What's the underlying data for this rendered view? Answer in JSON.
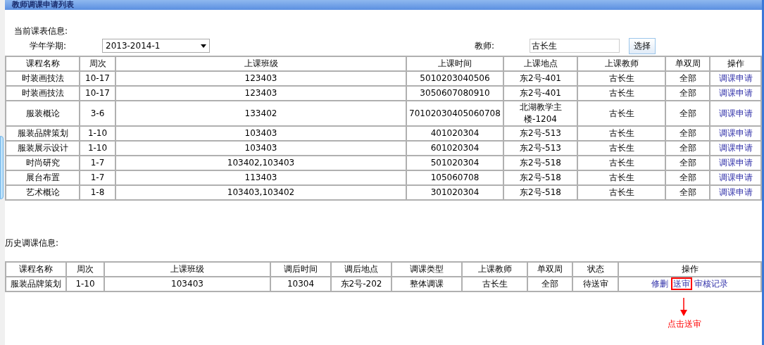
{
  "window": {
    "title": "教师调课申请列表"
  },
  "current": {
    "heading": "当前课表信息:",
    "term_label": "学年学期:",
    "term_value": "2013-2014-1",
    "teacher_label": "教师:",
    "teacher_value": "古长生",
    "choose_button": "选择"
  },
  "table": {
    "columns": [
      "课程名称",
      "周次",
      "上课班级",
      "上课时间",
      "上课地点",
      "上课教师",
      "单双周",
      "操作"
    ],
    "rows": [
      {
        "cells": [
          "时装画技法",
          "10-17",
          "123403",
          "5010203040506",
          "东2号-401",
          "古长生",
          "全部"
        ],
        "action": "调课申请"
      },
      {
        "cells": [
          "时装画技法",
          "10-17",
          "123403",
          "3050607080910",
          "东2号-401",
          "古长生",
          "全部"
        ],
        "action": "调课申请"
      },
      {
        "cells": [
          "服装概论",
          "3-6",
          "133402",
          "70102030405060708",
          "北湖教学主楼-1204",
          "古长生",
          "全部"
        ],
        "action": "调课申请"
      },
      {
        "cells": [
          "服装品牌策划",
          "1-10",
          "103403",
          "401020304",
          "东2号-513",
          "古长生",
          "全部"
        ],
        "action": "调课申请"
      },
      {
        "cells": [
          "服装展示设计",
          "1-10",
          "103403",
          "601020304",
          "东2号-513",
          "古长生",
          "全部"
        ],
        "action": "调课申请"
      },
      {
        "cells": [
          "时尚研究",
          "1-7",
          "103402,103403",
          "501020304",
          "东2号-518",
          "古长生",
          "全部"
        ],
        "action": "调课申请"
      },
      {
        "cells": [
          "展台布置",
          "1-7",
          "113403",
          "105060708",
          "东2号-518",
          "古长生",
          "全部"
        ],
        "action": "调课申请"
      },
      {
        "cells": [
          "艺术概论",
          "1-8",
          "103403,103402",
          "301020304",
          "东2号-518",
          "古长生",
          "全部"
        ],
        "action": "调课申请"
      }
    ]
  },
  "history": {
    "heading": "历史调课信息:",
    "columns": [
      "课程名称",
      "周次",
      "上课班级",
      "调后时间",
      "调后地点",
      "调课类型",
      "上课教师",
      "单双周",
      "状态",
      "操作"
    ],
    "rows": [
      {
        "cells": [
          "服装品牌策划",
          "1-10",
          "103403",
          "10304",
          "东2号-202",
          "整体调课",
          "古长生",
          "全部",
          "待送审"
        ],
        "actions": [
          {
            "label": "修删",
            "highlighted": false
          },
          {
            "label": "送审",
            "highlighted": true
          },
          {
            "label": "审核记录",
            "highlighted": false
          }
        ]
      }
    ]
  },
  "annotation": {
    "text": "点击送审"
  }
}
